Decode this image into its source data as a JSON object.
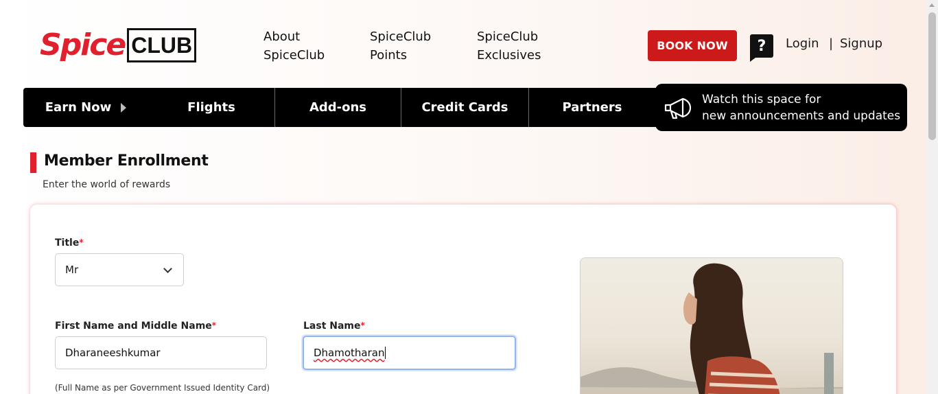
{
  "header": {
    "logo": {
      "spice": "Spice",
      "club": "CLUB"
    },
    "links": [
      {
        "label": "About SpiceClub"
      },
      {
        "label": "SpiceClub Points"
      },
      {
        "label": "SpiceClub Exclusives"
      }
    ],
    "book_now": "BOOK NOW",
    "help_glyph": "?",
    "login": "Login",
    "separator": "|",
    "signup": "Signup"
  },
  "nav": {
    "items": [
      {
        "label": "Earn Now"
      },
      {
        "label": "Flights"
      },
      {
        "label": "Add-ons"
      },
      {
        "label": "Credit Cards"
      },
      {
        "label": "Partners"
      }
    ],
    "announcement": {
      "line1": "Watch this space for",
      "line2": "new announcements and updates",
      "icon": "megaphone-icon"
    }
  },
  "page": {
    "title": "Member Enrollment",
    "subtitle": "Enter the world of rewards"
  },
  "form": {
    "title_label": "Title",
    "title_value": "Mr",
    "required_mark": "*",
    "first_name_label": "First Name and Middle Name",
    "first_name_value": "Dharaneeshkumar",
    "last_name_label": "Last Name",
    "last_name_value": "Dhamotharan",
    "name_hint": "(Full Name as per Government Issued Identity Card)"
  },
  "colors": {
    "brand_red": "#e0202c",
    "button_red": "#cc1a1a",
    "nav_bg": "#000000"
  }
}
